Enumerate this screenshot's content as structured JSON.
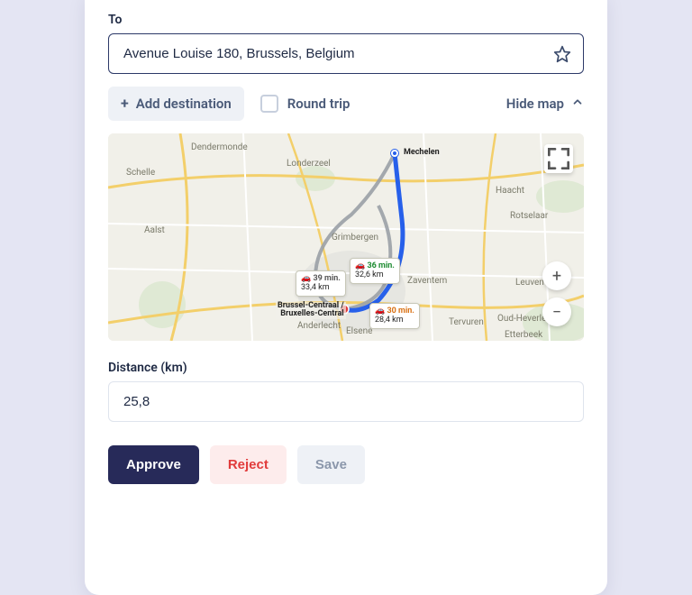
{
  "to": {
    "label": "To",
    "value": "Avenue Louise 180, Brussels, Belgium"
  },
  "controls": {
    "add_destination": "Add destination",
    "round_trip": "Round trip",
    "hide_map": "Hide map"
  },
  "map": {
    "start_label": "Mechelen",
    "end_label": "Brussel-Centraal /\nBruxelles-Central",
    "city_labels": [
      "Dendermonde",
      "Londerzeel",
      "Haacht",
      "Rotselaar",
      "Aalst",
      "Grimbergen",
      "Zaventem",
      "Leuven",
      "Tervuren",
      "Oud-Heverlee",
      "Etterbeek",
      "Anderlecht",
      "Elsene",
      "Schelle"
    ],
    "routes": [
      {
        "time": "39 min.",
        "dist": "33,4 km",
        "color": "gray"
      },
      {
        "time": "36 min.",
        "dist": "32,6 km",
        "color": "green"
      },
      {
        "time": "30 min.",
        "dist": "28,4 km",
        "color": "orange"
      }
    ]
  },
  "distance": {
    "label": "Distance (km)",
    "value": "25,8"
  },
  "actions": {
    "approve": "Approve",
    "reject": "Reject",
    "save": "Save"
  }
}
